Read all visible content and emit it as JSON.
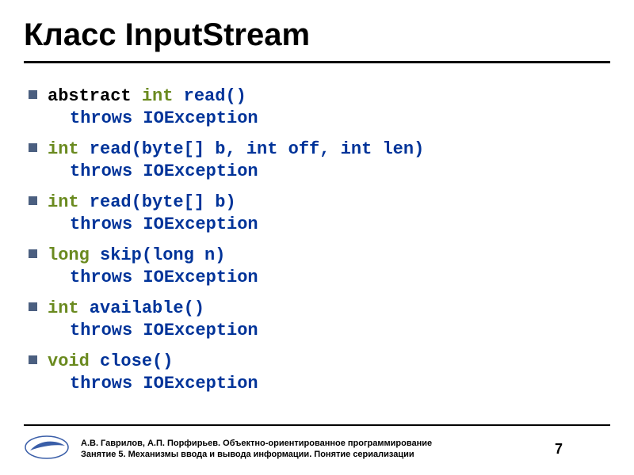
{
  "title": "Класс InputStream",
  "methods": [
    {
      "prefix": "abstract ",
      "type": "int",
      "sig": " read()",
      "throws": "throws IOException"
    },
    {
      "prefix": "",
      "type": "int",
      "sig": " read(byte[] b, int off, int len)",
      "throws": "throws IOException"
    },
    {
      "prefix": "",
      "type": "int",
      "sig": " read(byte[] b)",
      "throws": "throws IOException"
    },
    {
      "prefix": "",
      "type": "long",
      "sig": " skip(long n)",
      "throws": "throws IOException"
    },
    {
      "prefix": "",
      "type": "int",
      "sig": " available()",
      "throws": "throws IOException"
    },
    {
      "prefix": "",
      "type": "void",
      "sig": " close()",
      "throws": "throws IOException"
    }
  ],
  "footer": {
    "line1": "А.В. Гаврилов, А.П. Порфирьев. Объектно-ориентированное программирование",
    "line2": "Занятие 5. Механизмы ввода и вывода информации. Понятие сериализации"
  },
  "page": "7"
}
